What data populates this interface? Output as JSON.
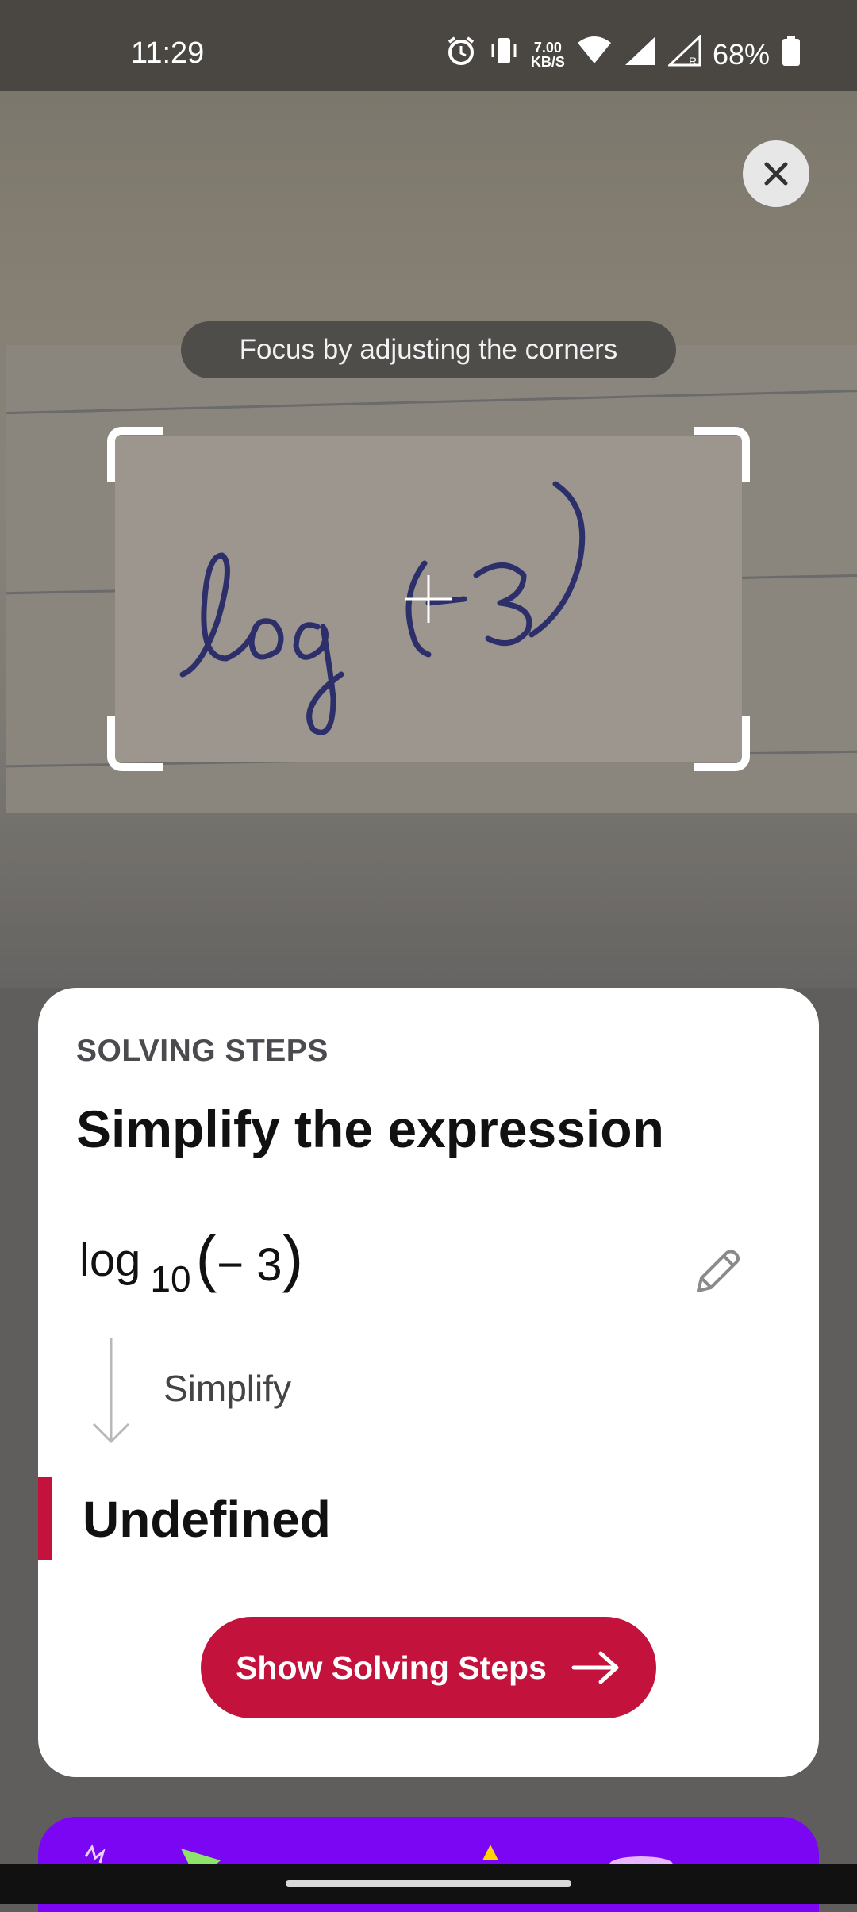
{
  "status_bar": {
    "time": "11:29",
    "net_speed_value": "7.00",
    "net_speed_unit": "KB/S",
    "battery": "68%"
  },
  "camera": {
    "focus_hint": "Focus by adjusting the corners"
  },
  "card": {
    "eyebrow": "SOLVING STEPS",
    "title": "Simplify the expression",
    "expression": {
      "function": "log",
      "base": "10",
      "open_paren": "(",
      "argument": "− 3",
      "close_paren": ")"
    },
    "step_label": "Simplify",
    "result": "Undefined",
    "cta_label": "Show Solving Steps"
  },
  "colors": {
    "accent": "#c3123b",
    "promo": "#7b06f3"
  }
}
